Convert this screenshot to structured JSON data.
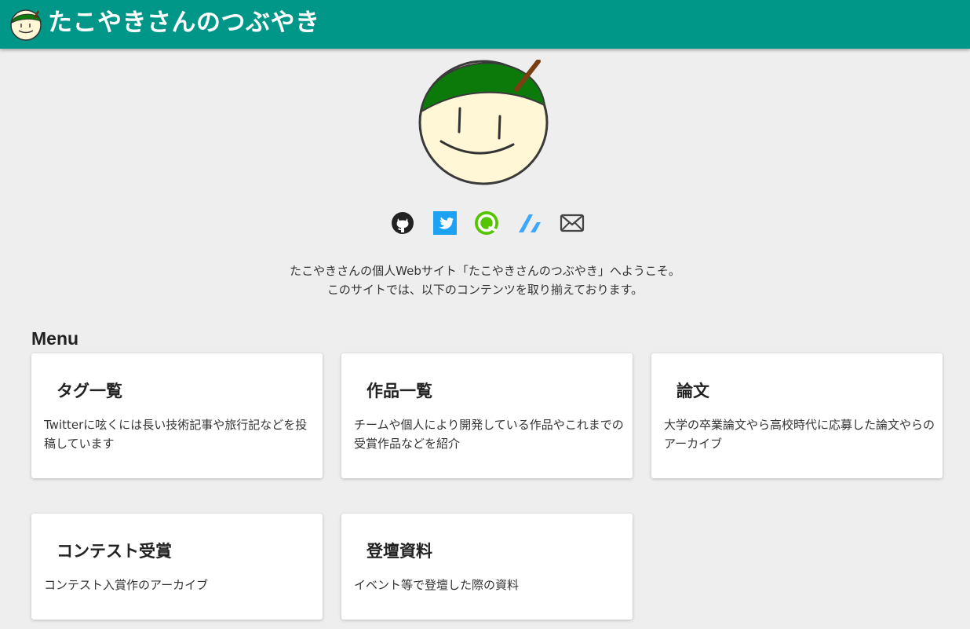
{
  "header": {
    "title": "たこやきさんのつぶやき",
    "logo_icon": "takoyaki-face-icon",
    "background": "#009688"
  },
  "profile": {
    "avatar_icon": "takoyaki-avatar-icon"
  },
  "social_links": [
    {
      "name": "github",
      "icon": "github-icon"
    },
    {
      "name": "twitter",
      "icon": "twitter-icon",
      "color": "#1da1f2"
    },
    {
      "name": "qiita",
      "icon": "qiita-icon",
      "color": "#55c500"
    },
    {
      "name": "zenn",
      "icon": "zenn-icon",
      "color": "#3ea8ff"
    },
    {
      "name": "mail",
      "icon": "mail-icon"
    }
  ],
  "intro": {
    "line1": "たこやきさんの個人Webサイト「たこやきさんのつぶやき」へようこそ。",
    "line2": "このサイトでは、以下のコンテンツを取り揃えております。"
  },
  "menu": {
    "heading": "Menu",
    "cards": [
      {
        "title": "タグ一覧",
        "description": "Twitterに呟くには長い技術記事や旅行記などを投稿しています"
      },
      {
        "title": "作品一覧",
        "description": "チームや個人により開発している作品やこれまでの受賞作品などを紹介"
      },
      {
        "title": "論文",
        "description": "大学の卒業論文やら高校時代に応募した論文やらのアーカイブ"
      },
      {
        "title": "コンテスト受賞",
        "description": "コンテスト入賞作のアーカイブ"
      },
      {
        "title": "登壇資料",
        "description": "イベント等で登壇した際の資料"
      }
    ]
  }
}
